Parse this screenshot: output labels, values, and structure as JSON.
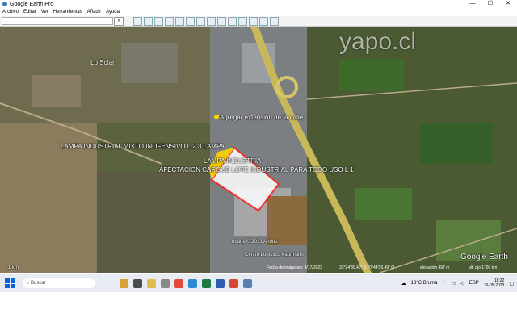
{
  "window": {
    "title": "Google Earth Pro",
    "controls": [
      "—",
      "☐",
      "✕"
    ]
  },
  "menu": [
    "Archivo",
    "Editar",
    "Ver",
    "Herramientas",
    "Añadir",
    "Ayuda"
  ],
  "map": {
    "watermark": "yapo.cl",
    "place_label": "Lo Solar",
    "placemark_label": "Agregar extensión de la calle",
    "polygon_labels": [
      "LAMPA INDUSTRIAL MIXTO INOFENSIVO L 2 3 LAMPA",
      "LAMPA INDUSTRIA",
      "AFECTACION CARGUE LOTE INDUSTRIAL PARA TODO USO L 1"
    ],
    "credits": "Image © 2023 Airbus",
    "poi_label": "Centro Logístico Kaufmann",
    "status": {
      "imagery_date": "Fecha de imágenes: 4/17/2023",
      "coordinates": "33°24'30.40\" S  70°44'36.49\" O",
      "elevation": "elevación 497 m",
      "eye_alt": "alt. ojo 1700 km"
    },
    "brand": "Google Earth",
    "scale_label": "1 km"
  },
  "taskbar": {
    "search_placeholder": "Buscar",
    "weather": "18°C  Bruma",
    "lang": "ESP",
    "time": "18:22",
    "date": "16-05-2023"
  }
}
